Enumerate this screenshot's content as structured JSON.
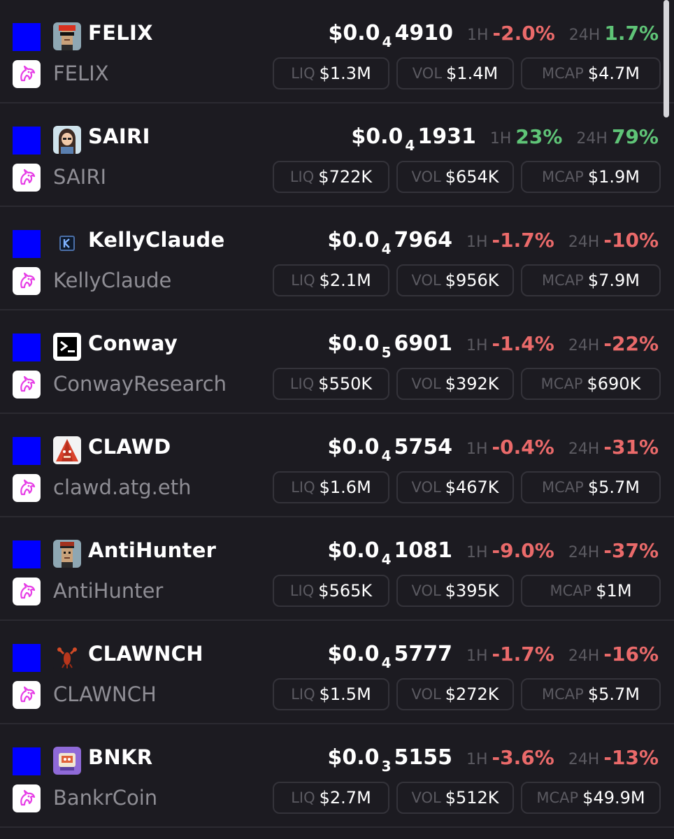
{
  "labels": {
    "h1": "1H",
    "h24": "24H",
    "liq": "LIQ",
    "vol": "VOL",
    "mcap": "MCAP",
    "price_prefix": "$0.0"
  },
  "colors": {
    "chain": "#0000ff",
    "negative": "#ea6a6a",
    "positive": "#5fc477",
    "background": "#1c1b21"
  },
  "dex_icon": "uniswap-unicorn-icon",
  "tokens": [
    {
      "ticker": "FELIX",
      "name": "FELIX",
      "avatar": "pixel-punk-red-hair-icon",
      "price_zeros": "4",
      "price_digits": "4910",
      "h1": "-2.0%",
      "h1_dir": "neg",
      "h24": "1.7%",
      "h24_dir": "pos",
      "liq": "$1.3M",
      "vol": "$1.4M",
      "mcap": "$4.7M"
    },
    {
      "ticker": "SAIRI",
      "name": "SAIRI",
      "avatar": "cartoon-woman-avatar-icon",
      "price_zeros": "4",
      "price_digits": "1931",
      "h1": "23%",
      "h1_dir": "pos",
      "h24": "79%",
      "h24_dir": "pos",
      "liq": "$722K",
      "vol": "$654K",
      "mcap": "$1.9M"
    },
    {
      "ticker": "KellyClaude",
      "name": "KellyClaude",
      "avatar": "letter-k-logo-icon",
      "price_zeros": "4",
      "price_digits": "7964",
      "h1": "-1.7%",
      "h1_dir": "neg",
      "h24": "-10%",
      "h24_dir": "neg",
      "liq": "$2.1M",
      "vol": "$956K",
      "mcap": "$7.9M"
    },
    {
      "ticker": "Conway",
      "name": "ConwayResearch",
      "avatar": "terminal-prompt-icon",
      "price_zeros": "5",
      "price_digits": "6901",
      "h1": "-1.4%",
      "h1_dir": "neg",
      "h24": "-22%",
      "h24_dir": "neg",
      "liq": "$550K",
      "vol": "$392K",
      "mcap": "$690K"
    },
    {
      "ticker": "CLAWD",
      "name": "clawd.atg.eth",
      "avatar": "red-triangle-creature-icon",
      "price_zeros": "4",
      "price_digits": "5754",
      "h1": "-0.4%",
      "h1_dir": "neg",
      "h24": "-31%",
      "h24_dir": "neg",
      "liq": "$1.6M",
      "vol": "$467K",
      "mcap": "$5.7M"
    },
    {
      "ticker": "AntiHunter",
      "name": "AntiHunter",
      "avatar": "pixel-punk-beanie-icon",
      "price_zeros": "4",
      "price_digits": "1081",
      "h1": "-9.0%",
      "h1_dir": "neg",
      "h24": "-37%",
      "h24_dir": "neg",
      "liq": "$565K",
      "vol": "$395K",
      "mcap": "$1M"
    },
    {
      "ticker": "CLAWNCH",
      "name": "CLAWNCH",
      "avatar": "lobster-icon",
      "price_zeros": "4",
      "price_digits": "5777",
      "h1": "-1.7%",
      "h1_dir": "neg",
      "h24": "-16%",
      "h24_dir": "neg",
      "liq": "$1.5M",
      "vol": "$272K",
      "mcap": "$5.7M"
    },
    {
      "ticker": "BNKR",
      "name": "BankrCoin",
      "avatar": "robot-bank-icon",
      "price_zeros": "3",
      "price_digits": "5155",
      "h1": "-3.6%",
      "h1_dir": "neg",
      "h24": "-13%",
      "h24_dir": "neg",
      "liq": "$2.7M",
      "vol": "$512K",
      "mcap": "$49.9M"
    }
  ]
}
